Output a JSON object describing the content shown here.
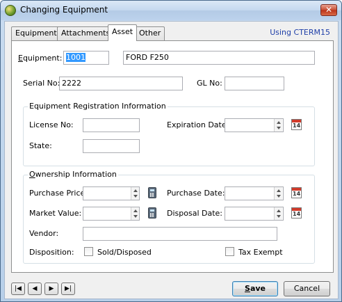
{
  "window": {
    "title": "Changing Equipment",
    "close_glyph": "✕"
  },
  "tabs": [
    {
      "label": "Equipment",
      "active": false
    },
    {
      "label": "Attachments",
      "active": false
    },
    {
      "label": "Asset",
      "active": true
    },
    {
      "label": "Other",
      "active": false
    }
  ],
  "using_label": "Using CTERM15",
  "form": {
    "equipment_label": "Equipment:",
    "equipment_id": "1001",
    "equipment_desc": "FORD F250",
    "serial_label": "Serial No:",
    "serial_value": "2222",
    "gl_label": "GL No:",
    "gl_value": ""
  },
  "registration": {
    "title": "Equipment Registration Information",
    "license_label": "License No:",
    "license_value": "",
    "expiration_label": "Expiration Date:",
    "expiration_value": "",
    "state_label": "State:",
    "state_value": ""
  },
  "ownership": {
    "title": "Ownership Information",
    "purchase_price_label": "Purchase Price:",
    "purchase_price_value": "",
    "purchase_date_label": "Purchase Date:",
    "purchase_date_value": "",
    "market_value_label": "Market Value:",
    "market_value_value": "",
    "disposal_date_label": "Disposal Date:",
    "disposal_date_value": "",
    "vendor_label": "Vendor:",
    "vendor_value": "",
    "disposition_label": "Disposition:",
    "sold_label": "Sold/Disposed",
    "sold_checked": false,
    "tax_exempt_label": "Tax Exempt",
    "tax_exempt_checked": false
  },
  "calendar_day": "14",
  "icons": {
    "app": "app-icon",
    "calendar": "calendar-icon",
    "calculator": "calculator-icon"
  },
  "nav": {
    "first": "|◀",
    "prev": "◀",
    "next": "▶",
    "last": "▶|"
  },
  "buttons": {
    "save": "Save",
    "cancel": "Cancel"
  },
  "colors": {
    "accent_link": "#1f3fa8",
    "selection": "#3399ff"
  }
}
